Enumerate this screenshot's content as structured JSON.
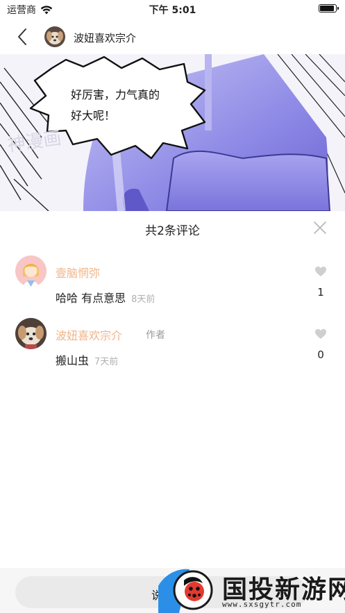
{
  "status_bar": {
    "carrier": "运营商",
    "time": "下午 5:01",
    "battery_level": 1.0
  },
  "header": {
    "title": "波妞喜欢宗介"
  },
  "comic": {
    "speech_line1": "好厉害，力气真的",
    "speech_line2": "好大呢！",
    "watermark": "神漫画"
  },
  "comments_panel": {
    "title": "共2条评论",
    "comments": [
      {
        "username": "壹脑惘弥",
        "badge": "",
        "text": "哈哈 有点意思",
        "time": "8天前",
        "likes": "1"
      },
      {
        "username": "波妞喜欢宗介",
        "badge": "作者",
        "text": "搬山虫",
        "time": "7天前",
        "likes": "0"
      }
    ]
  },
  "bottom_bar": {
    "input_text": "说点",
    "watermark_text": "国投新游网",
    "watermark_url": "www.sxsgytr.com"
  },
  "colors": {
    "username": "#f0b488",
    "comic_purple": "#8a86e0",
    "time_gray": "#b0b0b0"
  }
}
